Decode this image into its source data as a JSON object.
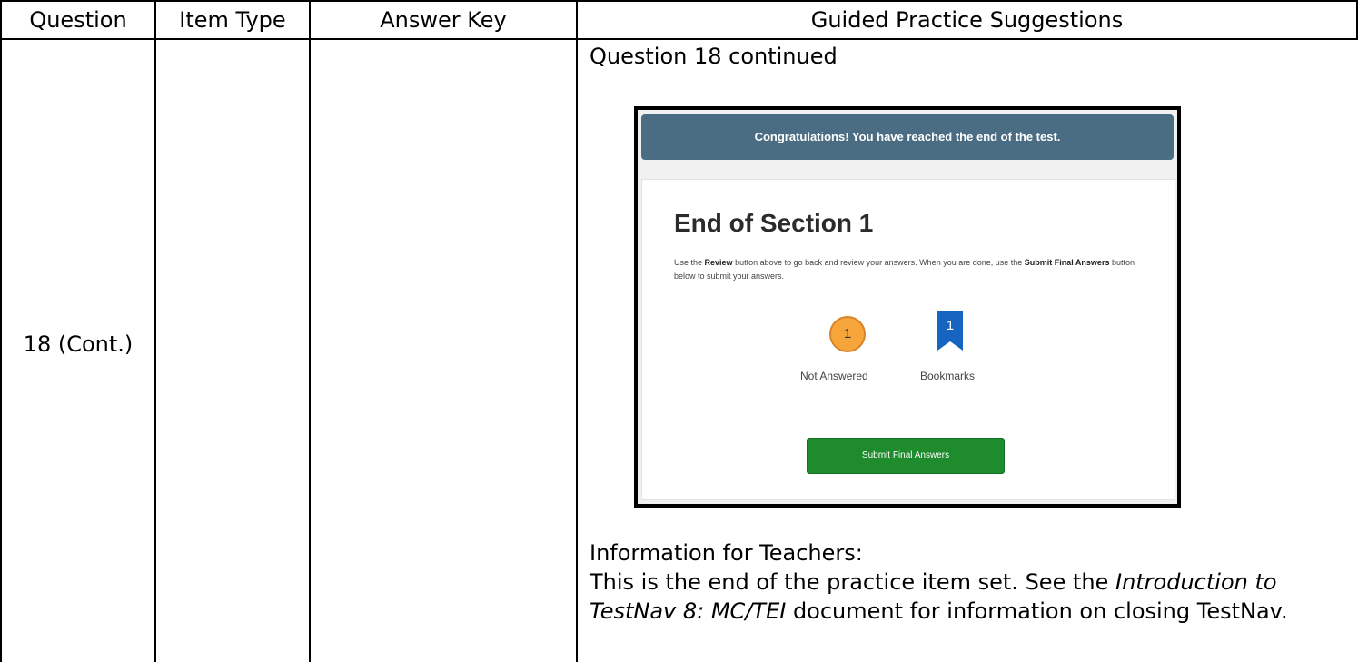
{
  "table": {
    "headers": [
      "Question",
      "Item Type",
      "Answer Key",
      "Guided Practice Suggestions"
    ],
    "row": {
      "question": "18 (Cont.)",
      "item_type": "",
      "answer_key": "",
      "guided_caption": "Question 18 continued"
    }
  },
  "screenshot": {
    "banner": "Congratulations! You have reached the end of the test.",
    "title": "End of Section 1",
    "instr_1": "Use the ",
    "instr_review": "Review",
    "instr_2": " button above to go back and review your answers. When you are done, use the ",
    "instr_submit": "Submit Final Answers",
    "instr_3": " button below to submit your answers.",
    "not_answered_count": "1",
    "not_answered_label": "Not Answered",
    "bookmarks_count": "1",
    "bookmarks_label": "Bookmarks",
    "submit_button": "Submit Final Answers",
    "colors": {
      "banner": "#4b6d83",
      "badge": "#f6a53b",
      "bookmark": "#1565c0",
      "button": "#1e8b2c"
    },
    "icons": [
      "not-answered-circle-icon",
      "bookmark-icon"
    ]
  },
  "teachers": {
    "heading": "Information for Teachers:",
    "line1_a": "This is the end of the practice item set.  See the ",
    "line1_b": "Introduction to",
    "line2_a": "TestNav 8:  MC/TEI",
    "line2_b": " document for information on closing TestNav."
  }
}
